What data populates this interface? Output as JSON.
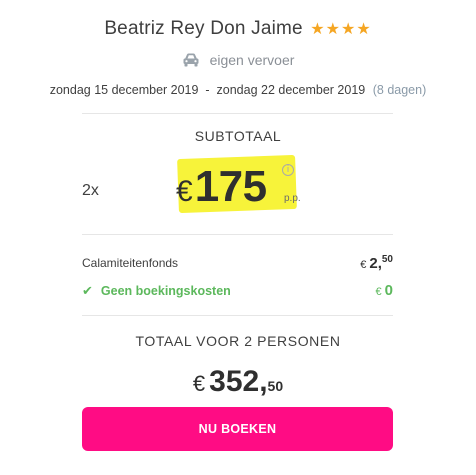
{
  "hotel": {
    "name": "Beatriz Rey Don Jaime",
    "stars": "★★★★"
  },
  "transport": {
    "icon": "car-icon",
    "label": "eigen vervoer"
  },
  "travel_dates": {
    "range": "zondag 15 december 2019  -  zondag 22 december 2019",
    "duration": "(8 dagen)"
  },
  "subtotal": {
    "heading": "SUBTOTAAL",
    "quantity": "2x",
    "currency": "€",
    "price": "175",
    "info_icon": "i",
    "per_person": "p.p."
  },
  "fees": {
    "calamity_label": "Calamiteitenfonds",
    "calamity_currency": "€",
    "calamity_whole": "2,",
    "calamity_cents": "50",
    "booking_label": "Geen boekingskosten",
    "booking_check": "✔",
    "booking_currency": "€",
    "booking_value": "0"
  },
  "total": {
    "heading": "TOTAAL VOOR 2 PERSONEN",
    "currency": "€",
    "whole": "352,",
    "cents": "50"
  },
  "actions": {
    "book_label": "NU BOEKEN"
  },
  "colors": {
    "accent": "#ff0c84",
    "highlight": "#f7f33a",
    "stars": "#f5a623",
    "success": "#5cb85c"
  }
}
